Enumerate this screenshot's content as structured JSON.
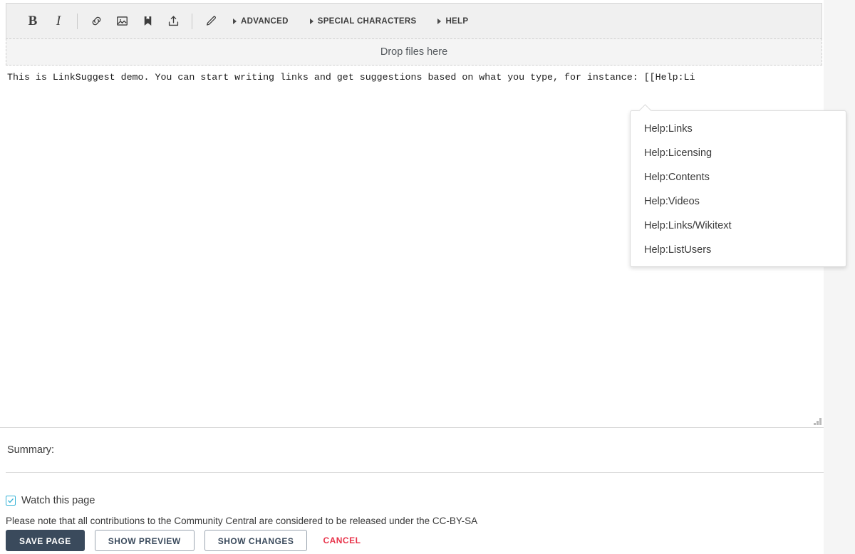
{
  "toolbar": {
    "buttons": [
      {
        "name": "bold-button",
        "label": "B",
        "title": "Bold"
      },
      {
        "name": "italic-button",
        "label": "I",
        "title": "Italic"
      },
      {
        "name": "link-icon",
        "label": "",
        "title": "Link"
      },
      {
        "name": "image-icon",
        "label": "",
        "title": "Image"
      },
      {
        "name": "bookmark-icon",
        "label": "",
        "title": "Gallery"
      },
      {
        "name": "upload-icon",
        "label": "",
        "title": "Upload"
      },
      {
        "name": "pencil-icon",
        "label": "",
        "title": "Signature"
      }
    ],
    "groups": [
      {
        "label": "ADVANCED"
      },
      {
        "label": "SPECIAL CHARACTERS"
      },
      {
        "label": "HELP"
      }
    ]
  },
  "dropzone": {
    "label": "Drop files here"
  },
  "editor": {
    "content": "This is LinkSuggest demo. You can start writing links and get suggestions based on what you type, for instance: [[Help:Li"
  },
  "suggestions": {
    "items": [
      {
        "label": "Help:Links"
      },
      {
        "label": "Help:Licensing"
      },
      {
        "label": "Help:Contents"
      },
      {
        "label": "Help:Videos"
      },
      {
        "label": "Help:Links/Wikitext"
      },
      {
        "label": "Help:ListUsers"
      }
    ]
  },
  "summary": {
    "label": "Summary:",
    "value": "",
    "placeholder": ""
  },
  "options": {
    "watch_label": "Watch this page",
    "watch_checked": true,
    "notice": "Please note that all contributions to the Community Central are considered to be released under the CC-BY-SA"
  },
  "actions": {
    "save_label": "SAVE PAGE",
    "preview_label": "SHOW PREVIEW",
    "changes_label": "SHOW CHANGES",
    "cancel_label": "CANCEL"
  },
  "colors": {
    "primary_button": "#3a4a5c",
    "cancel_text": "#e8334a",
    "checkbox_accent": "#36b3d6",
    "toolbar_bg": "#f0f0f0",
    "page_bg": "#f5f5f5"
  }
}
